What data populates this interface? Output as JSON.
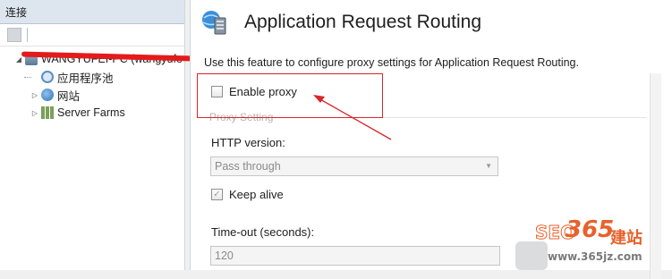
{
  "left_panel": {
    "header": "连接",
    "tree": {
      "root": "WANGYUFEI-PC (wangyufe",
      "children": [
        {
          "label": "应用程序池",
          "icon": "app-pool-icon"
        },
        {
          "label": "网站",
          "icon": "globe-icon"
        },
        {
          "label": "Server Farms",
          "icon": "server-farm-icon"
        }
      ]
    }
  },
  "main": {
    "title": "Application Request Routing",
    "description": "Use this feature to configure proxy settings for Application Request Routing.",
    "enable_proxy": {
      "label": "Enable proxy",
      "checked": false
    },
    "proxy_setting_group": "Proxy Setting",
    "http_version": {
      "label": "HTTP version:",
      "value": "Pass through"
    },
    "keep_alive": {
      "label": "Keep alive",
      "checked": true
    },
    "timeout": {
      "label": "Time-out (seconds):",
      "value": "120"
    }
  },
  "watermark": {
    "brand": "SEO",
    "number": "365",
    "site": "建站",
    "url": "www.365jz.com"
  },
  "colors": {
    "annotation_red": "#d9262a",
    "header_bg": "#dde5ef",
    "watermark_orange": "#e8612c"
  }
}
